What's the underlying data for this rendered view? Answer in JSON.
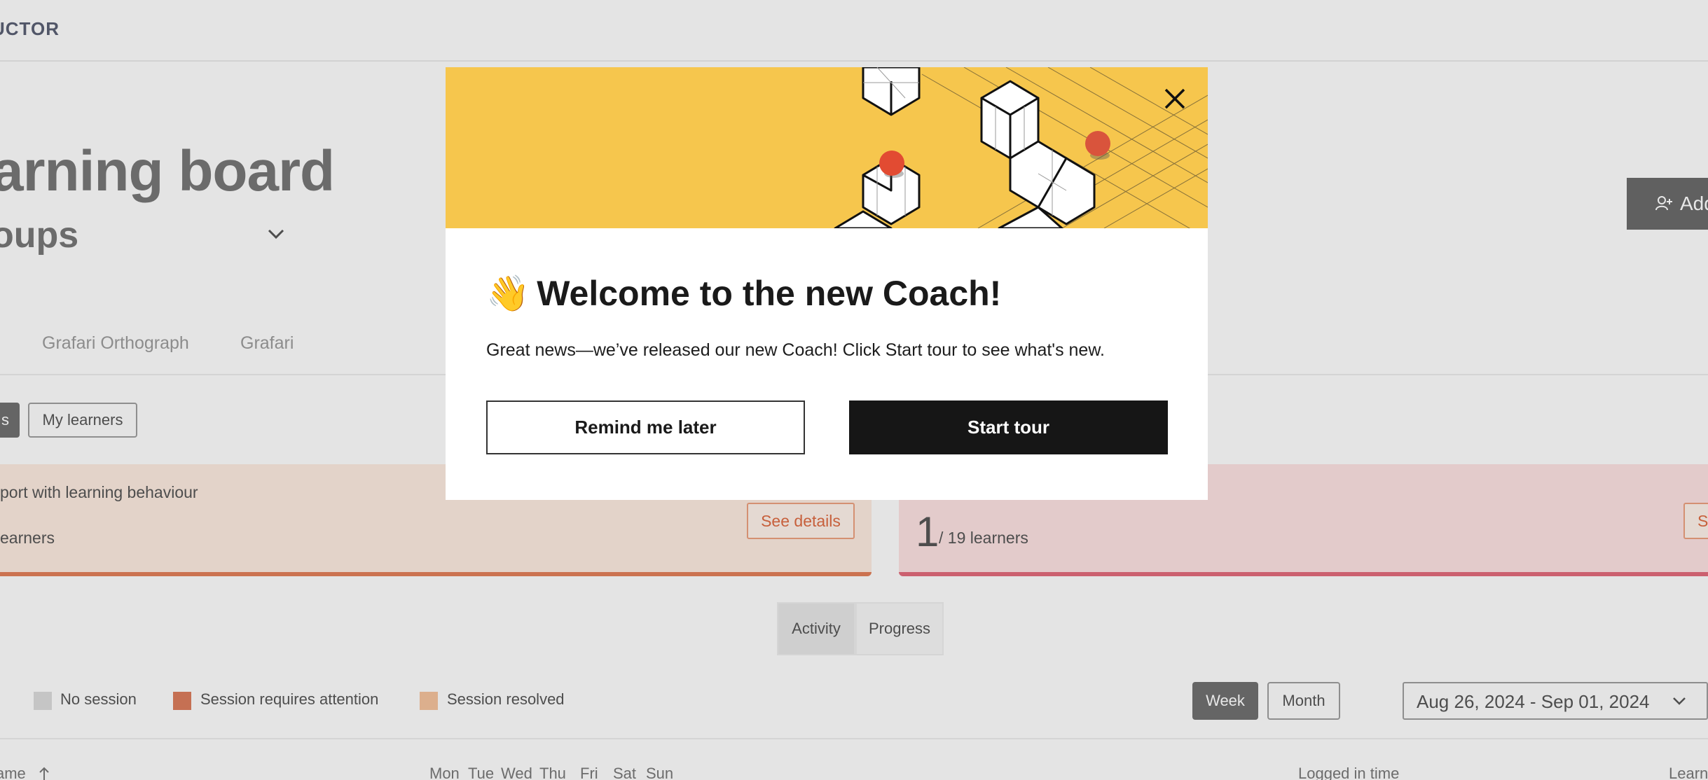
{
  "header": {
    "brand": "UCTOR"
  },
  "page": {
    "title": "arning board",
    "group_select": "oups",
    "add_button_label": "Add"
  },
  "tabs": [
    "Grafari Orthograph",
    "Grafari"
  ],
  "filters": {
    "active_label": "s",
    "my_learners_label": "My learners"
  },
  "cards": {
    "left": {
      "line1": "port with learning behaviour",
      "line2": "earners",
      "button": "See details"
    },
    "right": {
      "count": "1",
      "count_suffix": "/ 19 learners",
      "button": "Se"
    }
  },
  "view_toggle": {
    "activity": "Activity",
    "progress": "Progress"
  },
  "legend": [
    {
      "label": "No session",
      "color": "#d9d9d9"
    },
    {
      "label": "Session requires attention",
      "color": "#d97c5c"
    },
    {
      "label": "Session resolved",
      "color": "#f2c19c"
    }
  ],
  "range": {
    "week": "Week",
    "month": "Month",
    "date_range": "Aug 26, 2024 - Sep 01, 2024"
  },
  "table_headers": {
    "name": "ame",
    "days": [
      "Mon",
      "Tue",
      "Wed",
      "Thu",
      "Fri",
      "Sat",
      "Sun"
    ],
    "logged_in_time": "Logged in time",
    "learners": "Learn"
  },
  "modal": {
    "title": "Welcome to the new Coach!",
    "body": "Great news—we’ve released our new Coach! Click Start tour to see what's new.",
    "remind_label": "Remind me later",
    "start_label": "Start tour",
    "banner_color": "#f6c64d"
  }
}
